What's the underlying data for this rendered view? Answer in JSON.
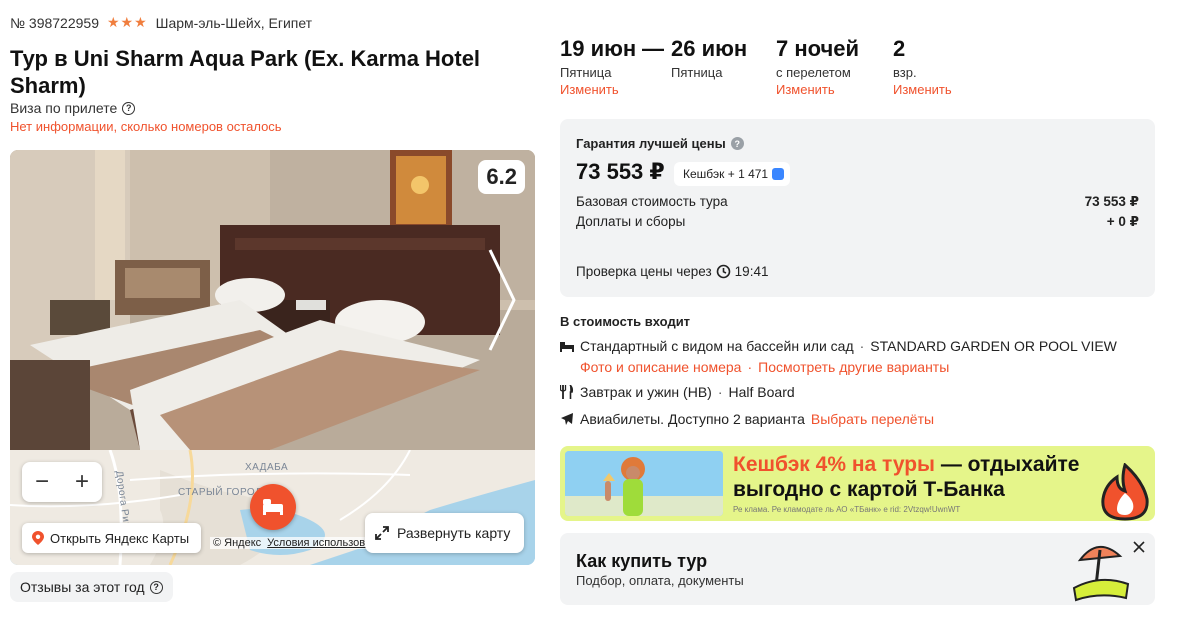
{
  "hotel": {
    "number": "№ 398722959",
    "stars": "★★★",
    "location": "Шарм-эль-Шейх, Египет",
    "title": "Тур в Uni Sharm Aqua Park (Ex. Karma Hotel Sharm)",
    "visa": "Виза по прилете",
    "rooms_info": "Нет информации, сколько номеров осталось",
    "rating": "6.2"
  },
  "map": {
    "label_khadaba": "ХАДАБА",
    "label_old_town": "СТАРЫЙ ГОРОД",
    "label_road": "Дорога Ринг",
    "open_yandex": "Открыть Яндекс Карты",
    "copyright": "© Яндекс",
    "terms": "Условия использования",
    "expand": "Развернуть карту"
  },
  "reviews_label": "Отзывы за этот год",
  "dates": {
    "from": "19 июн",
    "dash": "—",
    "to": "26 июн",
    "from_day": "Пятница",
    "to_day": "Пятница",
    "change": "Изменить",
    "nights": "7 ночей",
    "nights_note": "с перелетом",
    "adults": "2",
    "adults_note": "взр."
  },
  "price": {
    "guarantee": "Гарантия лучшей цены",
    "total": "73 553 ₽",
    "cashback": "Кешбэк + 1 471",
    "base_label": "Базовая стоимость тура",
    "base_value": "73 553 ₽",
    "fees_label": "Доплаты и сборы",
    "fees_value": "+ 0 ₽",
    "check_label": "Проверка цены через",
    "check_time": "19:41"
  },
  "included": {
    "title": "В стоимость входит",
    "room": "Стандартный с видом на бассейн или сад",
    "room_en": "STANDARD GARDEN OR POOL VIEW",
    "room_photo": "Фото и описание номера",
    "room_other": "Посмотреть другие варианты",
    "meal": "Завтрак и ужин (HB)",
    "meal_en": "Half Board",
    "flight": "Авиабилеты. Доступно 2 варианта",
    "flight_link": "Выбрать перелёты",
    "dot": "·"
  },
  "promo": {
    "headline_orange": "Кешбэк 4% на туры",
    "headline_rest_1": " — отдыхайте",
    "headline_line2": "выгодно с картой Т-Банка",
    "note": "Ре клама. Ре кламодате ль АО «ТБанк» е rid: 2Vtzqw!UwnWT"
  },
  "howto": {
    "title": "Как купить тур",
    "subtitle": "Подбор, оплата, документы"
  },
  "colors": {
    "accent": "#f0522d",
    "star": "#f07e3e",
    "panel": "#f2f3f4",
    "promo_bg": "#e5f58a"
  }
}
